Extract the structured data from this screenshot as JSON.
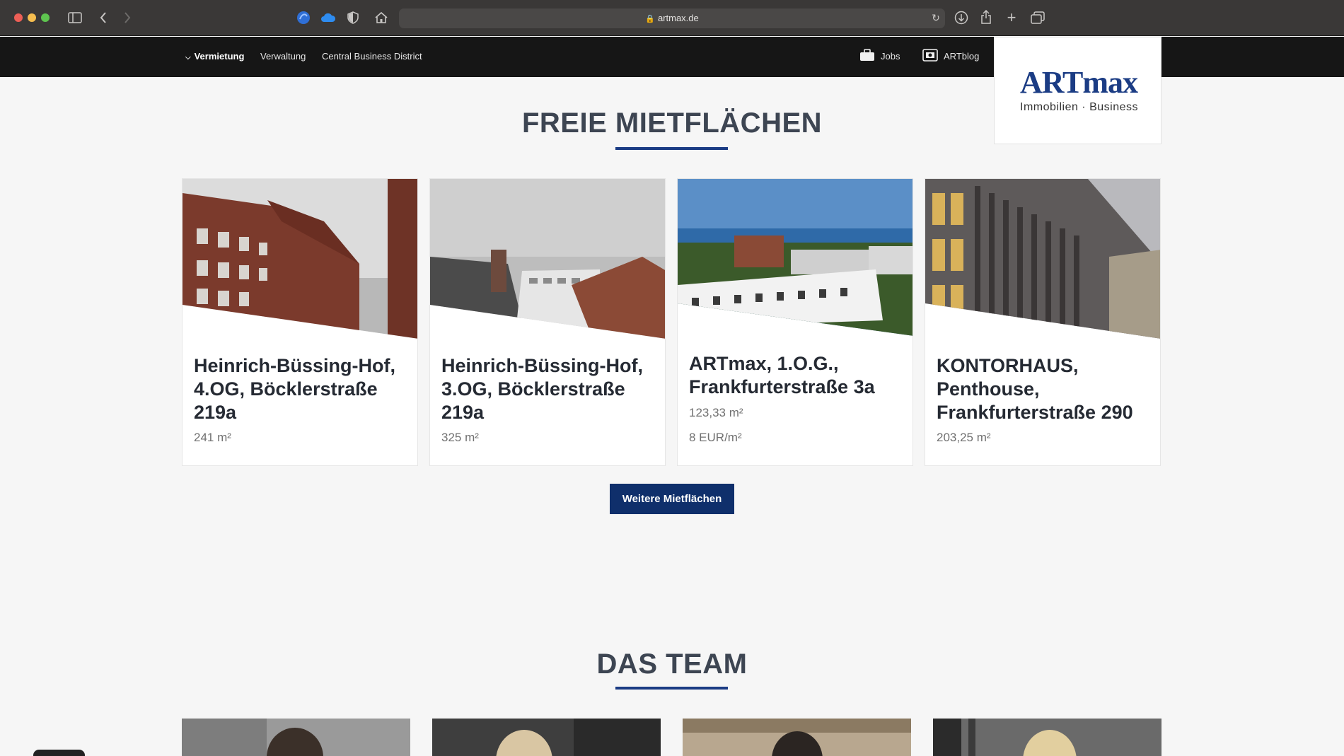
{
  "browser": {
    "url": "artmax.de"
  },
  "nav": {
    "items": [
      "Vermietung",
      "Verwaltung",
      "Central Business District"
    ],
    "jobs": "Jobs",
    "blog": "ARTblog"
  },
  "logo": {
    "main": "ARTmax",
    "sub": "Immobilien · Business"
  },
  "section1": {
    "title": "FREIE MIETFLÄCHEN",
    "button": "Weitere Mietflächen"
  },
  "cards": [
    {
      "title": "Heinrich-Büssing-Hof, 4.OG, Böcklerstraße 219a",
      "meta1": "241 m²",
      "meta2": ""
    },
    {
      "title": "Heinrich-Büssing-Hof, 3.OG, Böcklerstraße 219a",
      "meta1": "325 m²",
      "meta2": ""
    },
    {
      "title": "ARTmax, 1.O.G., Frankfurterstraße 3a",
      "meta1": "123,33 m²",
      "meta2": "8 EUR/m²"
    },
    {
      "title": "KONTORHAUS, Penthouse, Frankfurterstraße 290",
      "meta1": "203,25 m²",
      "meta2": ""
    }
  ],
  "section2": {
    "title": "DAS TEAM"
  },
  "colors": {
    "brand": "#1b3c84",
    "button": "#0f2f6b",
    "nav_bg": "#161616"
  },
  "icons": [
    "sidebar-toggle-icon",
    "back-icon",
    "forward-icon",
    "extension-icon",
    "cloud-icon",
    "shield-icon",
    "home-icon",
    "lock-icon",
    "reload-icon",
    "download-icon",
    "share-icon",
    "new-tab-icon",
    "tabs-overview-icon",
    "chevron-down-icon",
    "briefcase-icon",
    "blog-icon"
  ]
}
